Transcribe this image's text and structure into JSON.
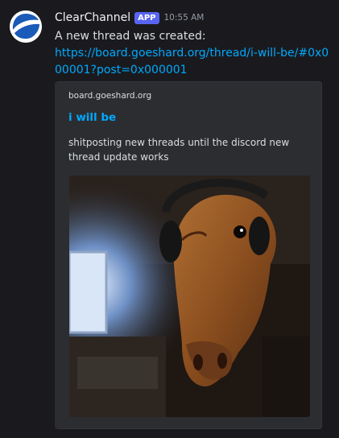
{
  "message": {
    "author": "ClearChannel",
    "badge": "APP",
    "timestamp": "10:55 AM",
    "text": "A new thread was created:",
    "link": "https://board.goeshard.org/thread/i-will-be/#0x000001?post=0x000001"
  },
  "embed": {
    "provider": "board.goeshard.org",
    "title": "i will be",
    "description": "shitposting new threads until the discord new thread update works",
    "image_icon": "horse-with-headphones-image"
  },
  "colors": {
    "background": "#1a1a1e",
    "link": "#00a8fc",
    "badge": "#5865f2",
    "embed_bg": "#2b2d31"
  }
}
